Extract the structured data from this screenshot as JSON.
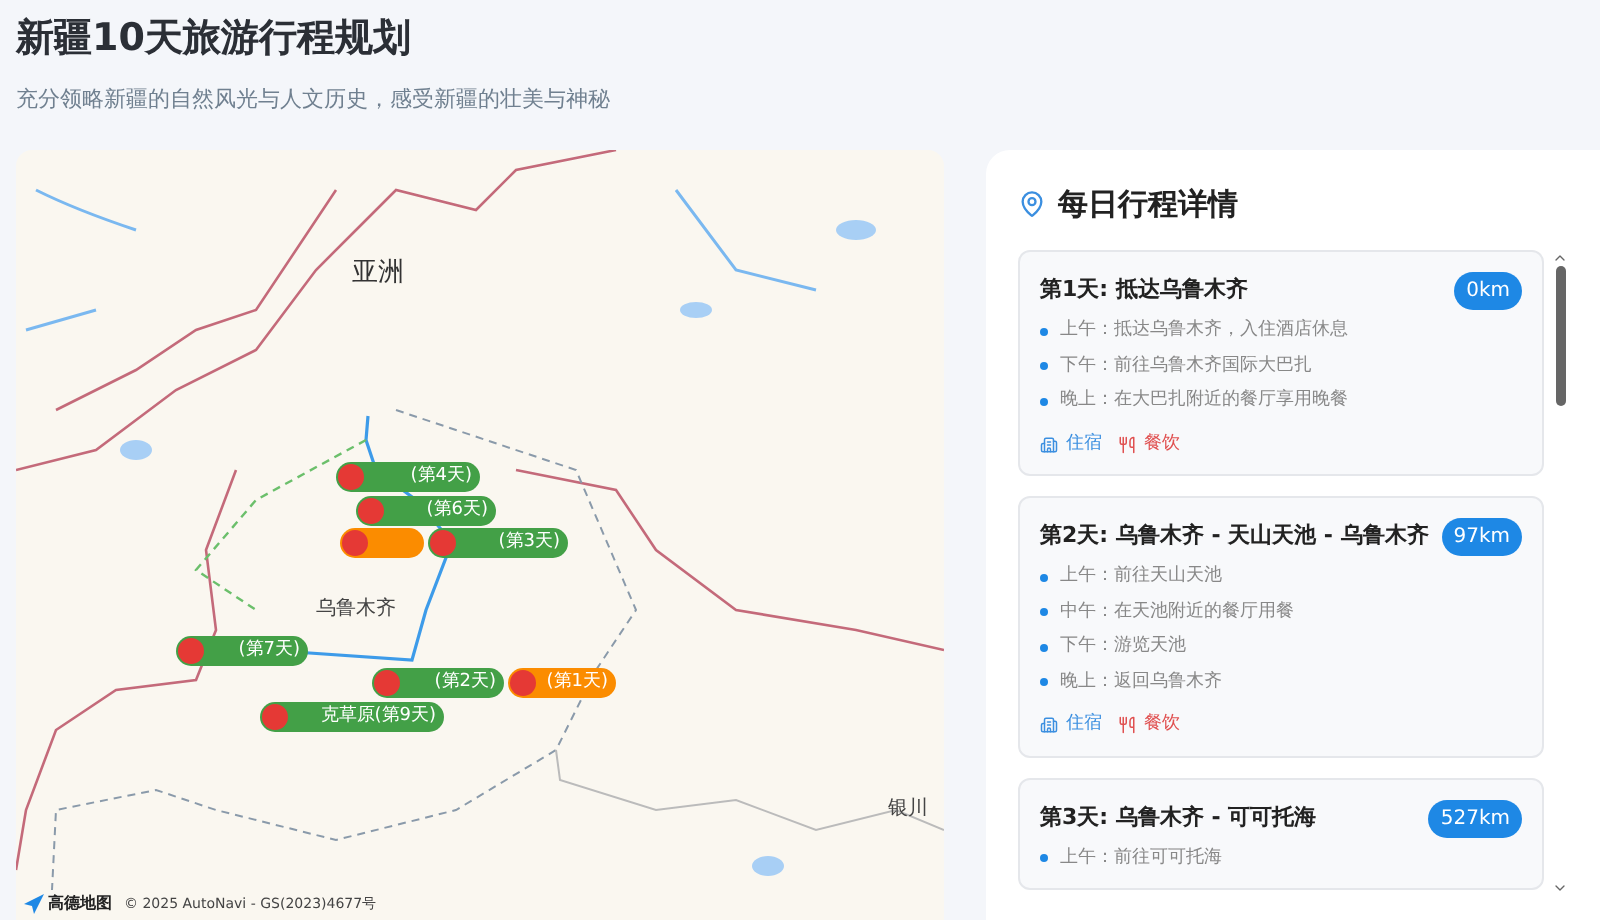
{
  "header": {
    "title": "新疆10天旅游行程规划",
    "subtitle": "充分领略新疆的自然风光与人文历史，感受新疆的壮美与神秘"
  },
  "map": {
    "labels": [
      {
        "text": "亚洲",
        "kind": "region"
      },
      {
        "text": "乌鲁木齐",
        "kind": "city"
      },
      {
        "text": "银川",
        "kind": "capital"
      }
    ],
    "markers": [
      {
        "label": "(第4天)",
        "color": "#43a047"
      },
      {
        "label": "(第6天)",
        "color": "#43a047"
      },
      {
        "color": "#fb8c00"
      },
      {
        "label": "(第3天)",
        "color": "#43a047"
      },
      {
        "label": "(第7天)",
        "color": "#43a047"
      },
      {
        "label": "(第2天)",
        "color": "#43a047"
      },
      {
        "label": "(第1天)",
        "color": "#fb8c00"
      },
      {
        "label": "克草原(第9天)",
        "color": "#43a047"
      }
    ],
    "logo": "高德地图",
    "attribution": "© 2025 AutoNavi - GS(2023)4677号"
  },
  "itinerary": {
    "title": "每日行程详情",
    "days": [
      {
        "title": "第1天: 抵达乌鲁木齐",
        "distance": "0km",
        "items": [
          "上午：抵达乌鲁木齐，入住酒店休息",
          "下午：前往乌鲁木齐国际大巴扎",
          "晚上：在大巴扎附近的餐厅享用晚餐"
        ],
        "tags": [
          {
            "kind": "lodging",
            "label": "住宿"
          },
          {
            "kind": "dining",
            "label": "餐饮"
          }
        ]
      },
      {
        "title": "第2天: 乌鲁木齐 - 天山天池 - 乌鲁木齐",
        "distance": "97km",
        "items": [
          "上午：前往天山天池",
          "中午：在天池附近的餐厅用餐",
          "下午：游览天池",
          "晚上：返回乌鲁木齐"
        ],
        "tags": [
          {
            "kind": "lodging",
            "label": "住宿"
          },
          {
            "kind": "dining",
            "label": "餐饮"
          }
        ]
      },
      {
        "title": "第3天: 乌鲁木齐 - 可可托海",
        "distance": "527km",
        "items": [
          "上午：前往可可托海"
        ]
      }
    ]
  }
}
